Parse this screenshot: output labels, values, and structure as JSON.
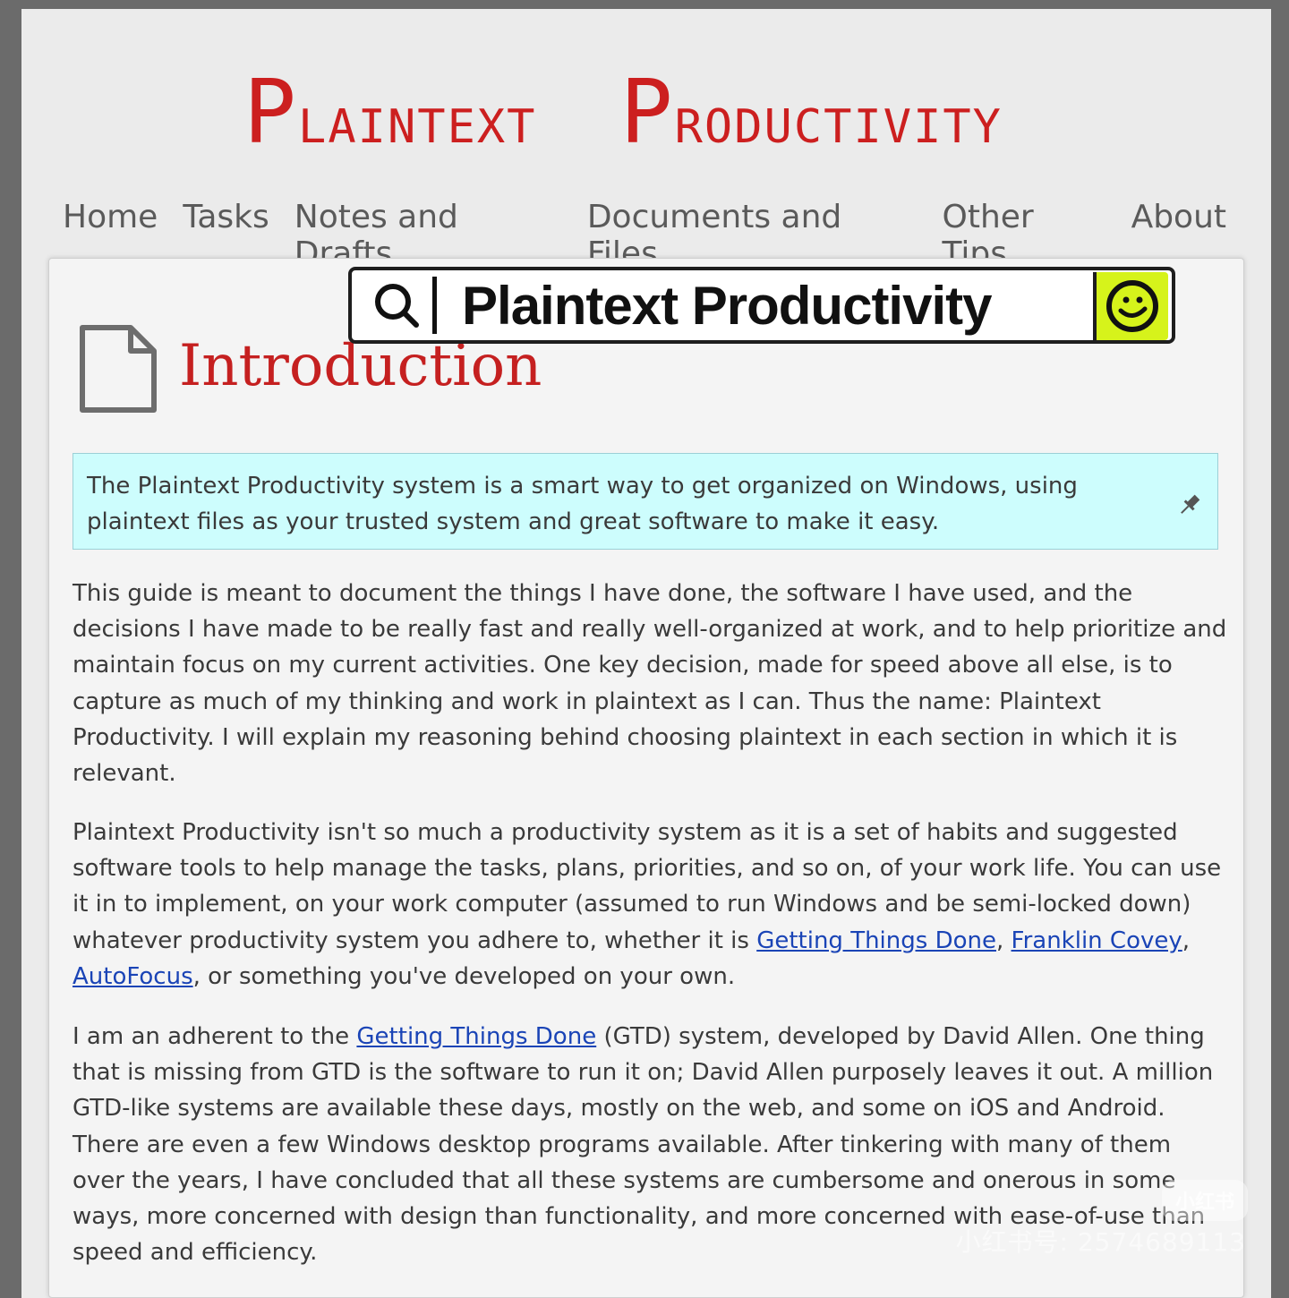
{
  "site": {
    "title_word1_initial": "P",
    "title_word1_rest": "laintext",
    "title_word2_initial": "P",
    "title_word2_rest": "roductivity"
  },
  "nav": {
    "items": [
      "Home",
      "Tasks",
      "Notes and Drafts",
      "Documents and Files",
      "Other Tips",
      "About"
    ]
  },
  "search_overlay": {
    "text": "Plaintext Productivity"
  },
  "page": {
    "heading": "Introduction",
    "callout": "The Plaintext Productivity system is a smart way to get organized on Windows, using plaintext files as your trusted system and great software to make it easy.",
    "p1": "This guide is meant to document the things I have done, the software I have used, and the decisions I have made to be really fast and really well-organized at work, and to help prioritize and maintain focus on my current activities. One key decision, made for speed above all else, is to capture as much of my thinking and work in plaintext as I can. Thus the name: Plaintext Productivity. I will explain my reasoning behind choosing plaintext in each section in which it is relevant.",
    "p2_a": "Plaintext Productivity isn't so much a productivity system as it is a set of habits and suggested software tools to help manage the tasks, plans, priorities, and so on, of your work life. You can use it in to implement, on your work computer (assumed to run Windows and be semi-locked down) whatever productivity system you adhere to, whether it is ",
    "p2_link1": "Getting Things Done",
    "p2_sep1": ", ",
    "p2_link2": "Franklin Covey",
    "p2_sep2": ", ",
    "p2_link3": "AutoFocus",
    "p2_b": ", or something you've developed on your own.",
    "p3_a": "I am an adherent to the ",
    "p3_link": "Getting Things Done",
    "p3_b": " (GTD) system, developed by David Allen. One thing that is missing from GTD is the software to run it on; David Allen purposely leaves it out. A million GTD-like systems are available these days, mostly on the web, and some on iOS and Android. There are even a few Windows desktop programs available. After tinkering with many of them over the years, I have concluded that all these systems are cumbersome and onerous in some ways, more concerned with design than functionality, and more concerned with ease-of-use than speed and efficiency."
  },
  "watermark": {
    "logo": "小红书",
    "id_text": "小红书号: 2574689113"
  },
  "colors": {
    "title_red": "#cc1f1f",
    "heading_red": "#c52020",
    "callout_bg": "#cdfdfd",
    "link_blue": "#1a44b6",
    "smile_button": "#d6f31b"
  }
}
